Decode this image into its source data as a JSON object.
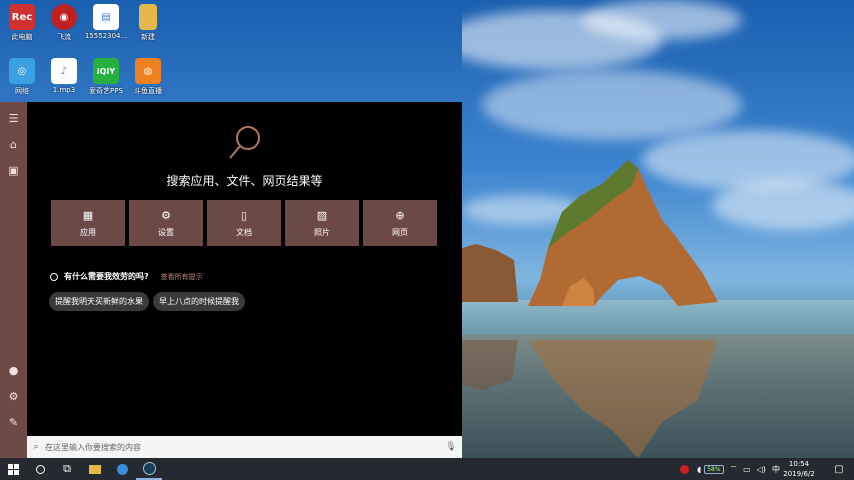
{
  "desktop": {
    "icons": [
      {
        "label": "此电脑",
        "glyph": "Rec",
        "color": "#d03030"
      },
      {
        "label": "飞流",
        "glyph": "◉",
        "color": "#c02020"
      },
      {
        "label": "15552304...",
        "glyph": "▤",
        "color": "#3b7dd8"
      },
      {
        "label": "新建",
        "glyph": "",
        "color": "#e6b84a"
      },
      {
        "label": "网络",
        "glyph": "◎",
        "color": "#3aa0e0"
      },
      {
        "label": "1.mp3",
        "glyph": "♪",
        "color": "#5a8ad0"
      },
      {
        "label": "爱奇艺PPS",
        "glyph": "iQIY",
        "color": "#26b040"
      },
      {
        "label": "斗鱼直播",
        "glyph": "◍",
        "color": "#f08020"
      }
    ]
  },
  "rail": {
    "menu_icon": "hamburger-icon",
    "home_icon": "home-icon",
    "notebook_icon": "notebook-icon",
    "account_icon": "person-icon",
    "settings_icon": "gear-icon",
    "feedback_icon": "feedback-icon"
  },
  "panel": {
    "headline": "搜索应用、文件、网页结果等",
    "tiles": [
      {
        "label": "应用",
        "icon": "apps-icon",
        "glyph": "▦"
      },
      {
        "label": "设置",
        "icon": "gear-icon",
        "glyph": "⚙"
      },
      {
        "label": "文档",
        "icon": "document-icon",
        "glyph": "▯"
      },
      {
        "label": "照片",
        "icon": "photo-icon",
        "glyph": "▨"
      },
      {
        "label": "网页",
        "icon": "globe-icon",
        "glyph": "⊕"
      }
    ],
    "suggest_question": "有什么需要我效劳的吗?",
    "suggest_more": "查看所有提示",
    "chips": [
      "提醒我明天买新鲜的水果",
      "早上八点的时候提醒我"
    ]
  },
  "searchbar": {
    "placeholder": "在这里输入你要搜索的内容",
    "value": ""
  },
  "taskbar": {
    "battery_percent": "58%",
    "time": "10:54",
    "date": "2019/6/2"
  },
  "colors": {
    "panel_bg": "#000000",
    "rail_bg": "#6e4a47",
    "tile_bg": "#6b4a46",
    "taskbar_bg": "#262a30"
  }
}
